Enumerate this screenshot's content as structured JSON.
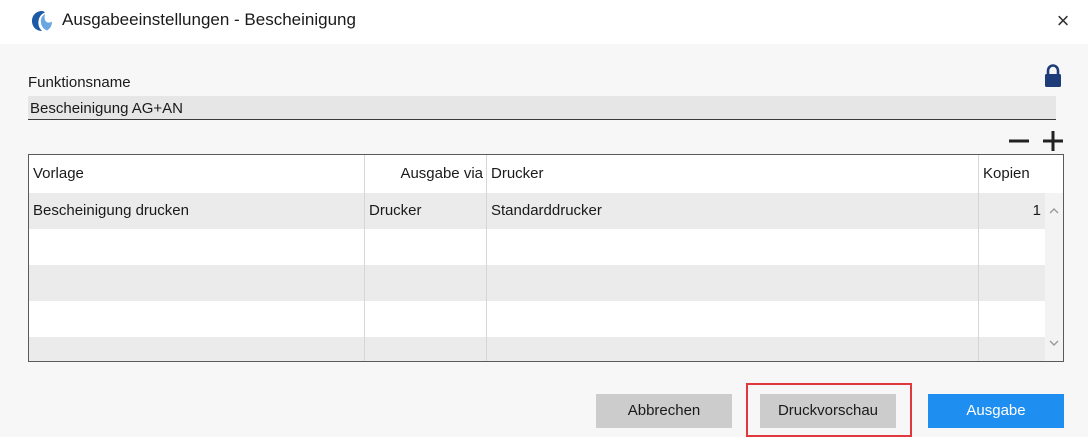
{
  "window": {
    "title": "Ausgabeeinstellungen - Bescheinigung",
    "close_label": "×"
  },
  "function_name": {
    "label": "Funktionsname",
    "value": "Bescheinigung AG+AN",
    "lock_icon": "lock-icon"
  },
  "table_actions": {
    "remove_icon": "minus-icon",
    "add_icon": "plus-icon"
  },
  "table": {
    "columns": [
      "Vorlage",
      "Ausgabe via",
      "Drucker",
      "Kopien"
    ],
    "rows": [
      [
        "Bescheinigung drucken",
        "Drucker",
        "Standarddrucker",
        "1"
      ],
      [
        "",
        "",
        "",
        ""
      ],
      [
        "",
        "",
        "",
        ""
      ],
      [
        "",
        "",
        "",
        ""
      ],
      [
        "",
        "",
        "",
        ""
      ]
    ]
  },
  "buttons": {
    "cancel": "Abbrechen",
    "preview": "Druckvorschau",
    "output": "Ausgabe"
  },
  "colors": {
    "primary": "#1f8ef1",
    "highlight": "#e0383e"
  }
}
